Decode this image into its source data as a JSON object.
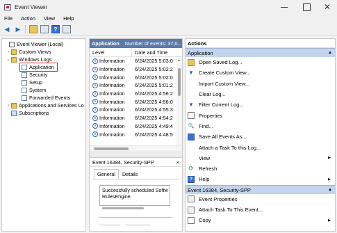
{
  "window": {
    "title": "Event Viewer"
  },
  "menu": [
    "File",
    "Action",
    "View",
    "Help"
  ],
  "tree": {
    "root": "Event Viewer (Local)",
    "custom_views": "Custom Views",
    "windows_logs": "Windows Logs",
    "application": "Application",
    "security": "Security",
    "setup": "Setup",
    "system": "System",
    "forwarded": "Forwarded Events",
    "apps_services": "Applications and Services Lo",
    "subscriptions": "Subscriptions"
  },
  "middle": {
    "title": "Application",
    "count": "Number of events: 37,0...",
    "col_level": "Level",
    "col_date": "Date and Time",
    "rows": [
      {
        "level": "Information",
        "date": "6/24/2025 5:03:0"
      },
      {
        "level": "Information",
        "date": "6/24/2025 5:02:2"
      },
      {
        "level": "Information",
        "date": "6/24/2025 5:02:0"
      },
      {
        "level": "Information",
        "date": "6/24/2025 5:01:2"
      },
      {
        "level": "Information",
        "date": "6/24/2025 4:56:2"
      },
      {
        "level": "Information",
        "date": "6/24/2025 4:56:0"
      },
      {
        "level": "Information",
        "date": "6/24/2025 4:55:3"
      },
      {
        "level": "Information",
        "date": "6/24/2025 4:54:2"
      },
      {
        "level": "Information",
        "date": "6/24/2025 4:49:4"
      },
      {
        "level": "Information",
        "date": "6/24/2025 4:48:5"
      }
    ]
  },
  "event": {
    "title": "Event 16384, Security-SPP",
    "close": "×",
    "tab_general": "General",
    "tab_details": "Details",
    "line1": "Successfully scheduled Softw",
    "line2": "RulesEngine."
  },
  "actions": {
    "title": "Actions",
    "section1": "Application",
    "items1": [
      "Open Saved Log...",
      "Create Custom View...",
      "Import Custom View...",
      "Clear Log...",
      "Filter Current Log...",
      "Properties",
      "Find...",
      "Save All Events As...",
      "Attach a Task To this Log...",
      "View",
      "Refresh",
      "Help"
    ],
    "section2": "Event 16384, Security-SPP",
    "items2": [
      "Event Properties",
      "Attach Task To This Event...",
      "Copy"
    ]
  }
}
